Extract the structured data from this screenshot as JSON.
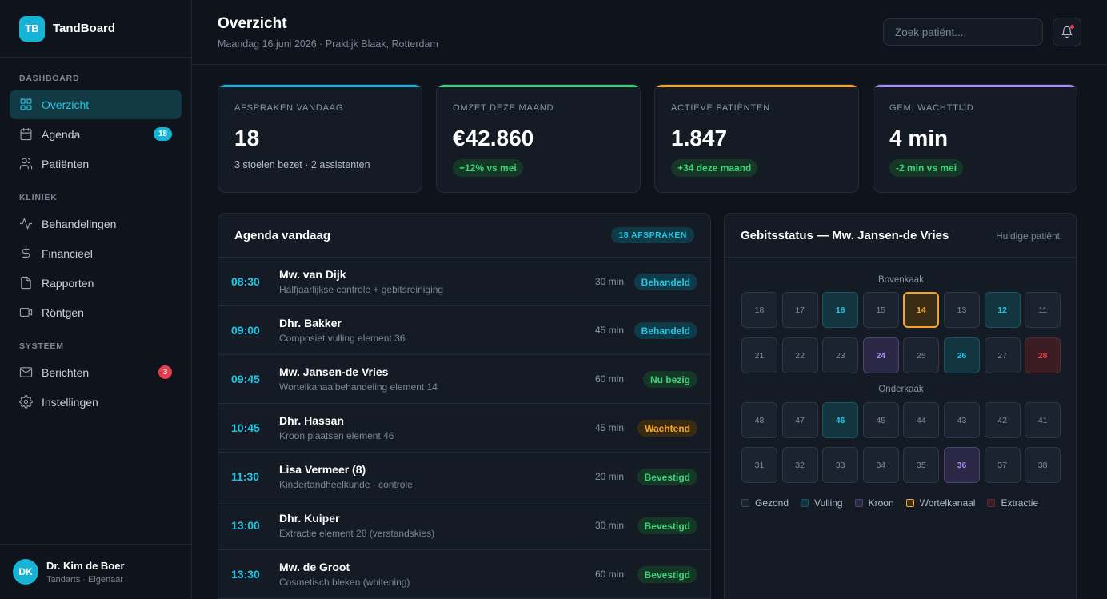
{
  "brand": {
    "logo": "TB",
    "name": "TandBoard"
  },
  "nav": {
    "sections": [
      {
        "title": "DASHBOARD",
        "items": [
          {
            "label": "Overzicht",
            "icon": "grid-icon",
            "active": true
          },
          {
            "label": "Agenda",
            "icon": "calendar-icon",
            "badge": "18"
          },
          {
            "label": "Patiënten",
            "icon": "users-icon"
          }
        ]
      },
      {
        "title": "KLINIEK",
        "items": [
          {
            "label": "Behandelingen",
            "icon": "activity-icon"
          },
          {
            "label": "Financieel",
            "icon": "dollar-icon"
          },
          {
            "label": "Rapporten",
            "icon": "file-icon"
          },
          {
            "label": "Röntgen",
            "icon": "xray-icon"
          }
        ]
      },
      {
        "title": "SYSTEEM",
        "items": [
          {
            "label": "Berichten",
            "icon": "mail-icon",
            "badge": "3"
          },
          {
            "label": "Instellingen",
            "icon": "gear-icon"
          }
        ]
      }
    ]
  },
  "user": {
    "initials": "DK",
    "name": "Dr. Kim de Boer",
    "role": "Tandarts · Eigenaar"
  },
  "header": {
    "title": "Overzicht",
    "subtitle": "Maandag 16 juni 2026 · Praktijk Blaak, Rotterdam",
    "search_placeholder": "Zoek patiënt..."
  },
  "stats": [
    {
      "label": "AFSPRAKEN VANDAAG",
      "value": "18",
      "sub": "3 stoelen bezet · 2 assistenten",
      "color": "#16b3d6"
    },
    {
      "label": "OMZET DEZE MAAND",
      "value": "€42.860",
      "pill": "+12% vs mei",
      "color": "#3ed27a"
    },
    {
      "label": "ACTIEVE PATIËNTEN",
      "value": "1.847",
      "pill": "+34 deze maand",
      "color": "#f5a524"
    },
    {
      "label": "GEM. WACHTTIJD",
      "value": "4 min",
      "pill": "-2 min vs mei",
      "color": "#a98bf0"
    }
  ],
  "agenda": {
    "title": "Agenda vandaag",
    "count": "18 AFSPRAKEN",
    "items": [
      {
        "time": "08:30",
        "name": "Mw. van Dijk",
        "desc": "Halfjaarlijkse controle + gebitsreiniging",
        "duration": "30 min",
        "status": "Behandeld",
        "kind": "done"
      },
      {
        "time": "09:00",
        "name": "Dhr. Bakker",
        "desc": "Composiet vulling element 36",
        "duration": "45 min",
        "status": "Behandeld",
        "kind": "done"
      },
      {
        "time": "09:45",
        "name": "Mw. Jansen-de Vries",
        "desc": "Wortelkanaalbehandeling element 14",
        "duration": "60 min",
        "status": "Nu bezig",
        "kind": "now"
      },
      {
        "time": "10:45",
        "name": "Dhr. Hassan",
        "desc": "Kroon plaatsen element 46",
        "duration": "45 min",
        "status": "Wachtend",
        "kind": "wait"
      },
      {
        "time": "11:30",
        "name": "Lisa Vermeer (8)",
        "desc": "Kindertandheelkunde · controle",
        "duration": "20 min",
        "status": "Bevestigd",
        "kind": "ok"
      },
      {
        "time": "13:00",
        "name": "Dhr. Kuiper",
        "desc": "Extractie element 28 (verstandskies)",
        "duration": "30 min",
        "status": "Bevestigd",
        "kind": "ok"
      },
      {
        "time": "13:30",
        "name": "Mw. de Groot",
        "desc": "Cosmetisch bleken (whitening)",
        "duration": "60 min",
        "status": "Bevestigd",
        "kind": "ok"
      }
    ]
  },
  "teeth": {
    "title": "Gebitsstatus — Mw. Jansen-de Vries",
    "hint": "Huidige patiënt",
    "upper_label": "Bovenkaak",
    "lower_label": "Onderkaak",
    "rows": [
      [
        [
          "18",
          "h"
        ],
        [
          "17",
          "h"
        ],
        [
          "16",
          "f"
        ],
        [
          "15",
          "h"
        ],
        [
          "14",
          "r"
        ],
        [
          "13",
          "h"
        ],
        [
          "12",
          "f"
        ],
        [
          "11",
          "h"
        ]
      ],
      [
        [
          "21",
          "h"
        ],
        [
          "22",
          "h"
        ],
        [
          "23",
          "h"
        ],
        [
          "24",
          "c"
        ],
        [
          "25",
          "h"
        ],
        [
          "26",
          "f"
        ],
        [
          "27",
          "h"
        ],
        [
          "28",
          "e"
        ]
      ],
      [
        [
          "48",
          "h"
        ],
        [
          "47",
          "h"
        ],
        [
          "46",
          "f"
        ],
        [
          "45",
          "h"
        ],
        [
          "44",
          "h"
        ],
        [
          "43",
          "h"
        ],
        [
          "42",
          "h"
        ],
        [
          "41",
          "h"
        ]
      ],
      [
        [
          "31",
          "h"
        ],
        [
          "32",
          "h"
        ],
        [
          "33",
          "h"
        ],
        [
          "34",
          "h"
        ],
        [
          "35",
          "h"
        ],
        [
          "36",
          "c"
        ],
        [
          "37",
          "h"
        ],
        [
          "38",
          "h"
        ]
      ]
    ],
    "legend": [
      {
        "label": "Gezond",
        "kind": "h"
      },
      {
        "label": "Vulling",
        "kind": "f"
      },
      {
        "label": "Kroon",
        "kind": "c"
      },
      {
        "label": "Wortelkanaal",
        "kind": "r"
      },
      {
        "label": "Extractie",
        "kind": "e"
      }
    ]
  },
  "colors": {
    "accent": "#16b3d6",
    "success": "#3ed27a",
    "warning": "#f5a524",
    "danger": "#e53e4a",
    "crown": "#a98bf0"
  }
}
